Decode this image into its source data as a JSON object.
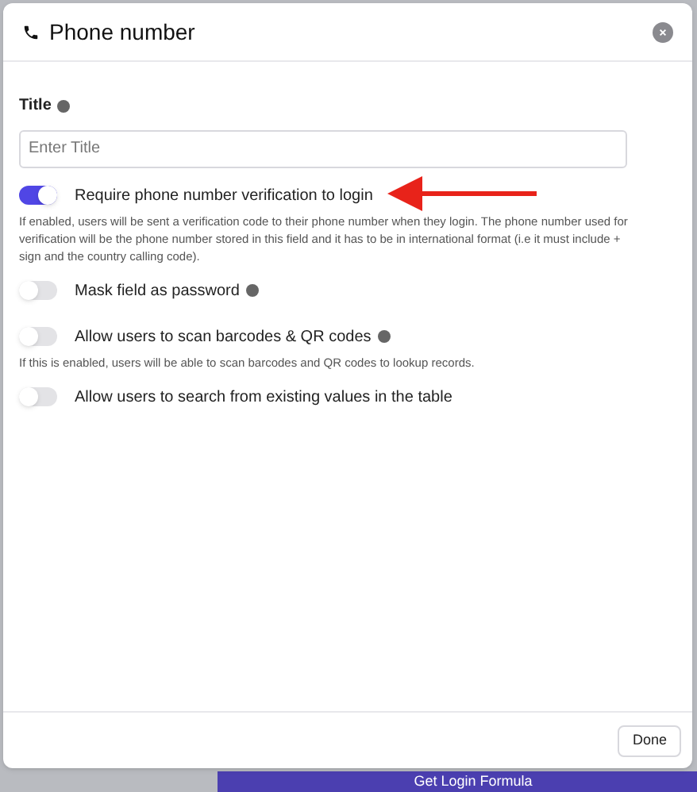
{
  "dialog": {
    "title": "Phone number"
  },
  "title_field": {
    "label": "Title",
    "placeholder": "Enter Title"
  },
  "options": [
    {
      "label": "Require phone number verification to login",
      "on": true,
      "help_icon": false,
      "description": "If enabled, users will be sent a verification code to their phone number when they login. The phone number used for verification will be the phone number stored in this field and it has to be in international format (i.e it must include + sign and the country calling code)."
    },
    {
      "label": "Mask field as password",
      "on": false,
      "help_icon": true
    },
    {
      "label": "Allow users to scan barcodes & QR codes",
      "on": false,
      "help_icon": true,
      "description": "If this is enabled, users will be able to scan barcodes and QR codes to lookup records."
    },
    {
      "label": "Allow users to search from existing values in the table",
      "on": false,
      "help_icon": false
    }
  ],
  "footer": {
    "button": "Done"
  },
  "background_button": "Get Login Formula"
}
